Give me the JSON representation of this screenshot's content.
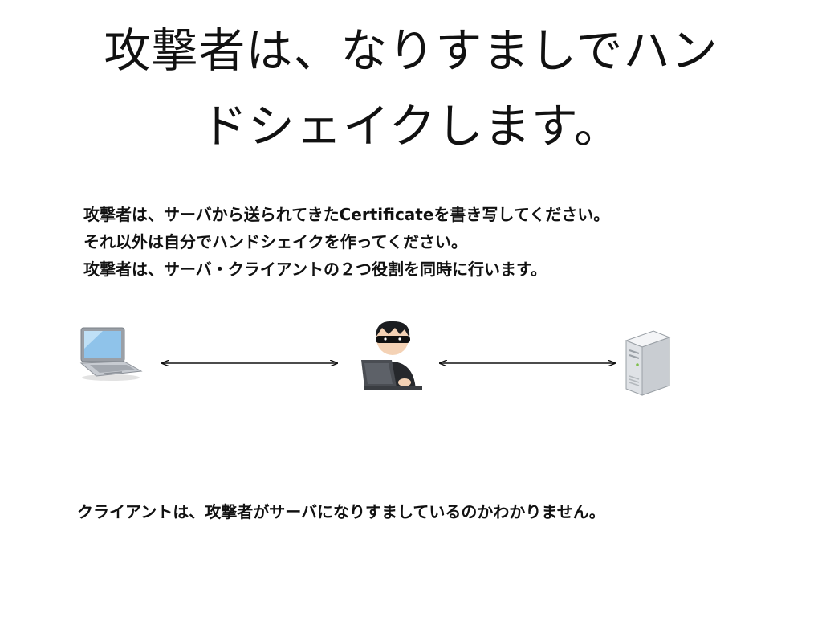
{
  "slide": {
    "title_lines": [
      "攻撃者は、なりすましでハン",
      "ドシェイクします。"
    ],
    "body_lines": [
      "攻撃者は、サーバから送られてきたCertificateを書き写してください。",
      "それ以外は自分でハンドシェイクを作ってください。",
      "攻撃者は、サーバ・クライアントの２つ役割を同時に行います。"
    ],
    "caption": "クライアントは、攻撃者がサーバになりすましているのかわかりません。"
  },
  "diagram": {
    "nodes": [
      {
        "role": "client",
        "icon": "laptop-icon"
      },
      {
        "role": "attacker",
        "icon": "masked-attacker-icon"
      },
      {
        "role": "server",
        "icon": "server-tower-icon"
      }
    ],
    "links": [
      {
        "from": "client",
        "to": "attacker",
        "style": "double-headed-arrow"
      },
      {
        "from": "attacker",
        "to": "server",
        "style": "double-headed-arrow"
      }
    ]
  },
  "colors": {
    "background": "#ffffff",
    "text": "#111111",
    "arrow": "#111111"
  }
}
